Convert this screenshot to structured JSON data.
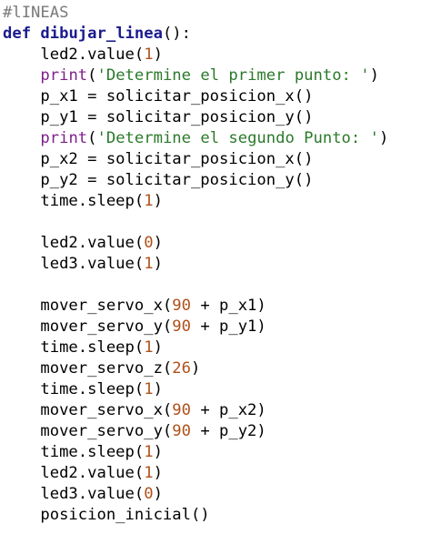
{
  "code_editor": {
    "language": "python",
    "colors": {
      "comment": "#7a7a7a",
      "keyword": "#1b1b8e",
      "builtin": "#7f1f8a",
      "string": "#2a7a2a",
      "number": "#b0501a",
      "text": "#000000"
    },
    "lines": [
      [
        {
          "t": "comment",
          "v": "#lINEAS"
        }
      ],
      [
        {
          "t": "kw",
          "v": "def"
        },
        {
          "t": "plain",
          "v": " "
        },
        {
          "t": "fn",
          "v": "dibujar_linea"
        },
        {
          "t": "plain",
          "v": "():"
        }
      ],
      [
        {
          "t": "plain",
          "v": "    led2.value("
        },
        {
          "t": "num",
          "v": "1"
        },
        {
          "t": "plain",
          "v": ")"
        }
      ],
      [
        {
          "t": "plain",
          "v": "    "
        },
        {
          "t": "builtin",
          "v": "print"
        },
        {
          "t": "plain",
          "v": "("
        },
        {
          "t": "str",
          "v": "'Determine el primer punto: '"
        },
        {
          "t": "plain",
          "v": ")"
        }
      ],
      [
        {
          "t": "plain",
          "v": "    p_x1 = solicitar_posicion_x()"
        }
      ],
      [
        {
          "t": "plain",
          "v": "    p_y1 = solicitar_posicion_y()"
        }
      ],
      [
        {
          "t": "plain",
          "v": "    "
        },
        {
          "t": "builtin",
          "v": "print"
        },
        {
          "t": "plain",
          "v": "("
        },
        {
          "t": "str",
          "v": "'Determine el segundo Punto: '"
        },
        {
          "t": "plain",
          "v": ")"
        }
      ],
      [
        {
          "t": "plain",
          "v": "    p_x2 = solicitar_posicion_x()"
        }
      ],
      [
        {
          "t": "plain",
          "v": "    p_y2 = solicitar_posicion_y()"
        }
      ],
      [
        {
          "t": "plain",
          "v": "    time.sleep("
        },
        {
          "t": "num",
          "v": "1"
        },
        {
          "t": "plain",
          "v": ")"
        }
      ],
      [],
      [
        {
          "t": "plain",
          "v": "    led2.value("
        },
        {
          "t": "num",
          "v": "0"
        },
        {
          "t": "plain",
          "v": ")"
        }
      ],
      [
        {
          "t": "plain",
          "v": "    led3.value("
        },
        {
          "t": "num",
          "v": "1"
        },
        {
          "t": "plain",
          "v": ")"
        }
      ],
      [],
      [
        {
          "t": "plain",
          "v": "    mover_servo_x("
        },
        {
          "t": "num",
          "v": "90"
        },
        {
          "t": "plain",
          "v": " + p_x1)"
        }
      ],
      [
        {
          "t": "plain",
          "v": "    mover_servo_y("
        },
        {
          "t": "num",
          "v": "90"
        },
        {
          "t": "plain",
          "v": " + p_y1)"
        }
      ],
      [
        {
          "t": "plain",
          "v": "    time.sleep("
        },
        {
          "t": "num",
          "v": "1"
        },
        {
          "t": "plain",
          "v": ")"
        }
      ],
      [
        {
          "t": "plain",
          "v": "    mover_servo_z("
        },
        {
          "t": "num",
          "v": "26"
        },
        {
          "t": "plain",
          "v": ")"
        }
      ],
      [
        {
          "t": "plain",
          "v": "    time.sleep("
        },
        {
          "t": "num",
          "v": "1"
        },
        {
          "t": "plain",
          "v": ")"
        }
      ],
      [
        {
          "t": "plain",
          "v": "    mover_servo_x("
        },
        {
          "t": "num",
          "v": "90"
        },
        {
          "t": "plain",
          "v": " + p_x2)"
        }
      ],
      [
        {
          "t": "plain",
          "v": "    mover_servo_y("
        },
        {
          "t": "num",
          "v": "90"
        },
        {
          "t": "plain",
          "v": " + p_y2)"
        }
      ],
      [
        {
          "t": "plain",
          "v": "    time.sleep("
        },
        {
          "t": "num",
          "v": "1"
        },
        {
          "t": "plain",
          "v": ")"
        }
      ],
      [
        {
          "t": "plain",
          "v": "    led2.value("
        },
        {
          "t": "num",
          "v": "1"
        },
        {
          "t": "plain",
          "v": ")"
        }
      ],
      [
        {
          "t": "plain",
          "v": "    led3.value("
        },
        {
          "t": "num",
          "v": "0"
        },
        {
          "t": "plain",
          "v": ")"
        }
      ],
      [
        {
          "t": "plain",
          "v": "    posicion_inicial()"
        }
      ]
    ]
  }
}
